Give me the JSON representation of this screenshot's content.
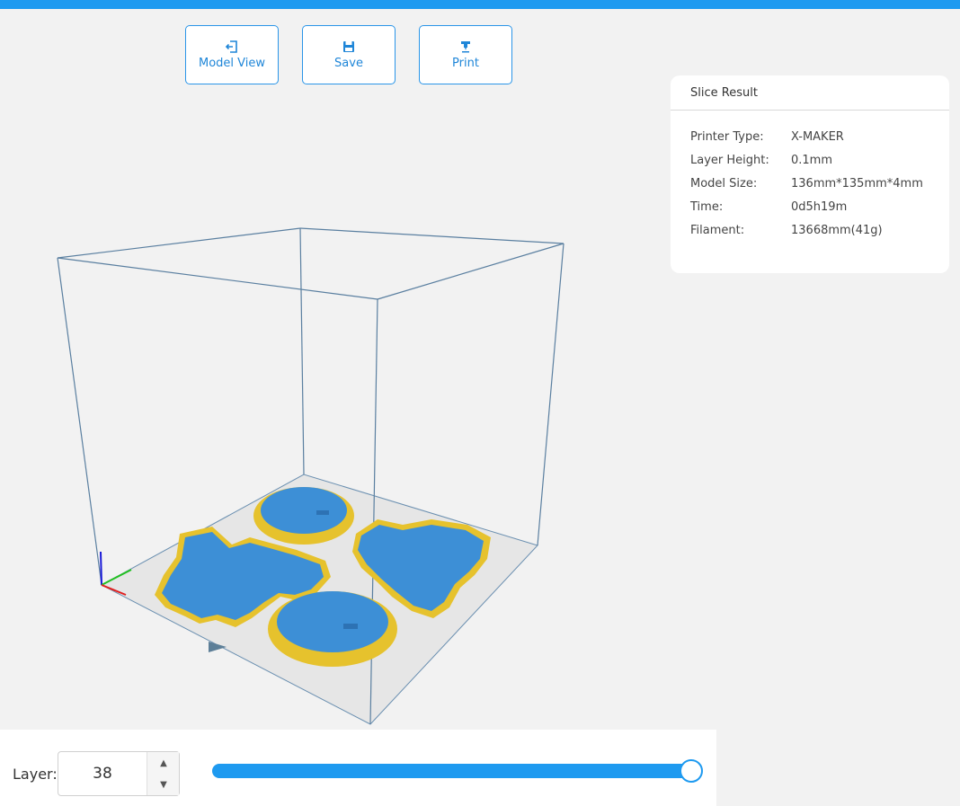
{
  "toolbar": {
    "model_view_label": "Model View",
    "save_label": "Save",
    "print_label": "Print"
  },
  "slice_result": {
    "title": "Slice Result",
    "rows": [
      {
        "key": "Printer Type:",
        "value": "X-MAKER"
      },
      {
        "key": "Layer Height:",
        "value": "0.1mm"
      },
      {
        "key": "Model Size:",
        "value": "136mm*135mm*4mm"
      },
      {
        "key": "Time:",
        "value": "0d5h19m"
      },
      {
        "key": "Filament:",
        "value": "13668mm(41g)"
      }
    ]
  },
  "layer_control": {
    "label": "Layer:",
    "value": "38",
    "slider_fraction": 1.0
  },
  "icons": {
    "model_view": "exit-to-model-icon",
    "save": "floppy-disk-icon",
    "print": "printer-nozzle-icon",
    "spin_up": "caret-up-icon",
    "spin_down": "caret-down-icon"
  },
  "colors": {
    "accent": "#1e9af0",
    "model_blue": "#3d8fd6",
    "infill_yellow": "#e6c22d",
    "build_box": "#5a7fa0",
    "bed": "#e6e6e6"
  }
}
